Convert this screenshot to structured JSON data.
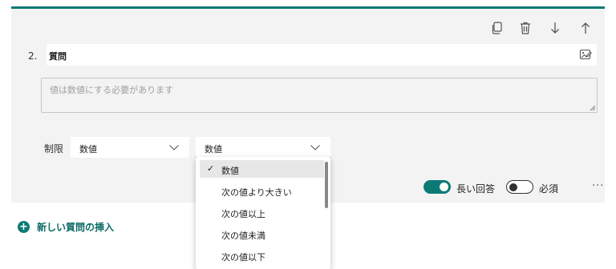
{
  "question": {
    "number": "2.",
    "title": "質問",
    "answer_placeholder": "値は数値にする必要があります"
  },
  "toolbar": {
    "icons": [
      "copy-icon",
      "delete-icon",
      "move-down-icon",
      "move-up-icon"
    ]
  },
  "restriction": {
    "label": "制限",
    "type_value": "数値",
    "condition_value": "数値"
  },
  "dropdown": {
    "options": [
      "数値",
      "次の値より大きい",
      "次の値以上",
      "次の値未満",
      "次の値以下"
    ],
    "selected": "数値"
  },
  "footer": {
    "long_answer_label": "長い回答",
    "long_answer_on": true,
    "required_label": "必須",
    "required_on": false,
    "more": "···"
  },
  "insert": {
    "label": "新しい質問の挿入"
  },
  "colors": {
    "accent": "#0b7a75"
  }
}
